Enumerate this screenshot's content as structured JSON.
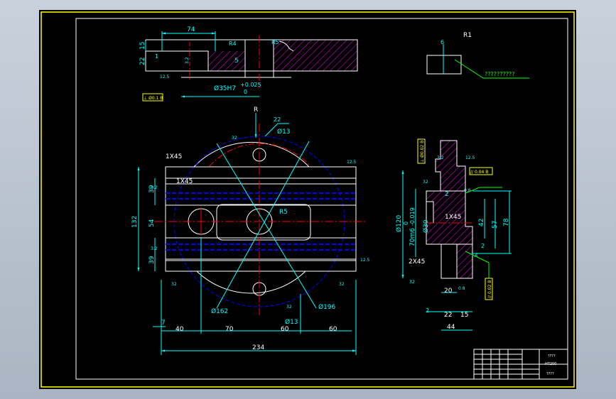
{
  "colors": {
    "frame": "#ffff00",
    "outline": "#ffffff",
    "dimension": "#00ffff",
    "center": "#ff0000",
    "hidden": "#0000ff",
    "hatch": "#ff00ff",
    "note": "#00ff00",
    "background": "#000000"
  },
  "top_view": {
    "dim_74": "74",
    "dim_15": "15",
    "dim_22": "22",
    "dim_1": "1",
    "dim_r4": "R4",
    "dim_5": "5",
    "dim_r5": "R5",
    "dim_bore": "Ø35H7",
    "tol_upper": "+0.025",
    "tol_lower": "0",
    "rough_1": "12.5",
    "rough_2": "3.2",
    "tol_frame": "⊥ Ø0.1 B"
  },
  "detail_view": {
    "dim_6": "6",
    "label_r1": "R1",
    "note": "??????????"
  },
  "front_view": {
    "label_r": "R",
    "dim_22": "22",
    "dim_d13_top": "Ø13",
    "dim_1x45_a": "1X45",
    "dim_1x45_b": "1X45",
    "dim_39_top": "39",
    "dim_54": "54",
    "dim_132": "132",
    "dim_39_bottom": "39",
    "dim_r5": "R5",
    "dim_d162": "Ø162",
    "dim_d13_bottom": "Ø13",
    "dim_d196": "Ø196",
    "dim_7": "7",
    "dim_40": "40",
    "dim_70": "70",
    "dim_60_a": "60",
    "dim_60_b": "60",
    "dim_234": "234",
    "rough_a": "32",
    "rough_b": "12.5",
    "rough_c": "32",
    "rough_d": "32",
    "rough_e": "32",
    "rough_f": "12.5",
    "rough_g": "3.2",
    "rough_h": "3.2"
  },
  "section_view": {
    "dim_d120": "Ø120",
    "dim_70m6": "70m6",
    "tol_upper": "0",
    "tol_lower": "-0.019",
    "dim_d30": "Ø30",
    "dim_1x45": "1X45",
    "dim_2x45": "2X45",
    "dim_2": "2",
    "dim_42": "42",
    "dim_57": "57",
    "dim_78": "78",
    "dim_20": "20",
    "dim_22": "22",
    "dim_15": "15",
    "dim_44": "44",
    "dim_2_small": "2",
    "dim_2_right": "2",
    "tol_frame_1": "⊥ Ø0.02 B",
    "tol_frame_2": "// 0.04 B",
    "tol_frame_3": "// 0.02 B",
    "rough_1": "3.2",
    "rough_2": "12.5",
    "rough_3": "32",
    "rough_4": "0.8",
    "rough_5": "1.6",
    "rough_6": "32",
    "rough_7": "0.8"
  },
  "title_block": {
    "name": "????",
    "material": "HT200",
    "drawing_no": "????"
  }
}
